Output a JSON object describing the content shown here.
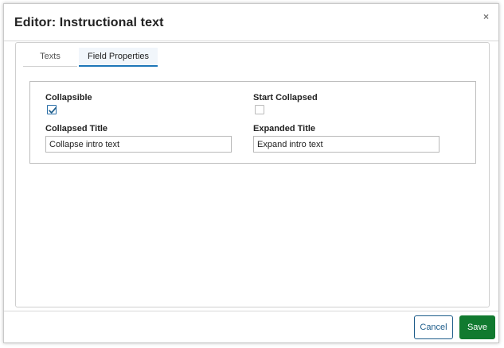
{
  "dialog": {
    "title": "Editor: Instructional text",
    "close_glyph": "×"
  },
  "tabs": [
    {
      "label": "Texts",
      "active": false
    },
    {
      "label": "Field Properties",
      "active": true
    }
  ],
  "fields": {
    "collapsible": {
      "label": "Collapsible",
      "checked": true
    },
    "start_collapsed": {
      "label": "Start Collapsed",
      "checked": false
    },
    "collapsed_title": {
      "label": "Collapsed Title",
      "value": "Collapse intro text"
    },
    "expanded_title": {
      "label": "Expanded Title",
      "value": "Expand intro text"
    }
  },
  "footer": {
    "cancel_label": "Cancel",
    "save_label": "Save"
  },
  "colors": {
    "accent": "#1d76b8",
    "save": "#117a2f",
    "cancel_border": "#1d5c8a"
  }
}
